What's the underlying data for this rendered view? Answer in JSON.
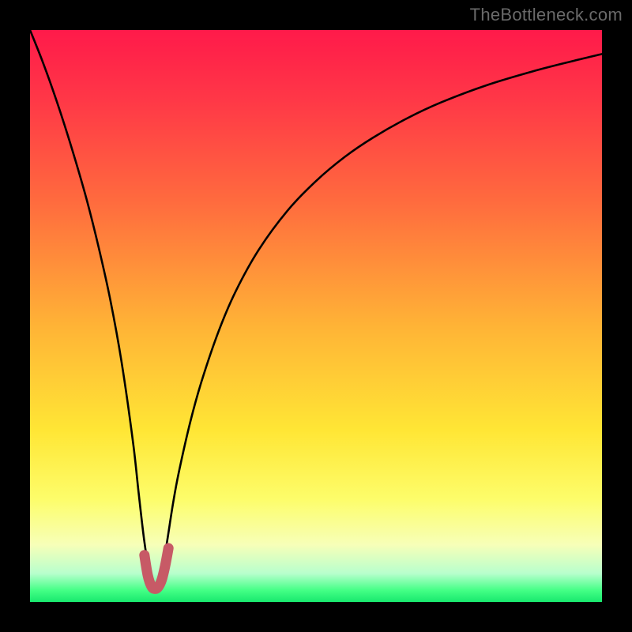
{
  "watermark": "TheBottleneck.com",
  "colors": {
    "page_bg": "#000000",
    "curve_stroke": "#000000",
    "marker_stroke": "#c75a66",
    "gradient_top": "#ff1a4a",
    "gradient_bottom": "#18e86e"
  },
  "chart_data": {
    "type": "line",
    "title": "",
    "xlabel": "",
    "ylabel": "",
    "xlim": [
      0,
      100
    ],
    "ylim": [
      0,
      100
    ],
    "grid": false,
    "legend": false,
    "annotations": [],
    "minimum_x": 22,
    "series": [
      {
        "name": "bottleneck-curve",
        "x": [
          0,
          2,
          4,
          6,
          8,
          10,
          12,
          14,
          16,
          18,
          19,
          20,
          21,
          22,
          23,
          24,
          25,
          26,
          28,
          30,
          33,
          36,
          40,
          45,
          50,
          55,
          60,
          66,
          72,
          80,
          88,
          95,
          100
        ],
        "y": [
          100,
          95,
          89.5,
          83.5,
          77,
          70,
          62,
          53,
          42,
          28,
          19,
          10.5,
          4.5,
          2.3,
          4.6,
          10.8,
          17.2,
          22.6,
          31.4,
          38.6,
          47.4,
          54.4,
          61.6,
          68.4,
          73.6,
          77.8,
          81.2,
          84.6,
          87.4,
          90.4,
          92.8,
          94.6,
          95.8
        ]
      },
      {
        "name": "minimum-marker",
        "x": [
          20.0,
          20.6,
          21.2,
          21.8,
          22.4,
          23.0,
          23.6,
          24.2
        ],
        "y": [
          8.2,
          4.6,
          2.8,
          2.3,
          2.6,
          3.8,
          6.2,
          9.4
        ]
      }
    ]
  }
}
